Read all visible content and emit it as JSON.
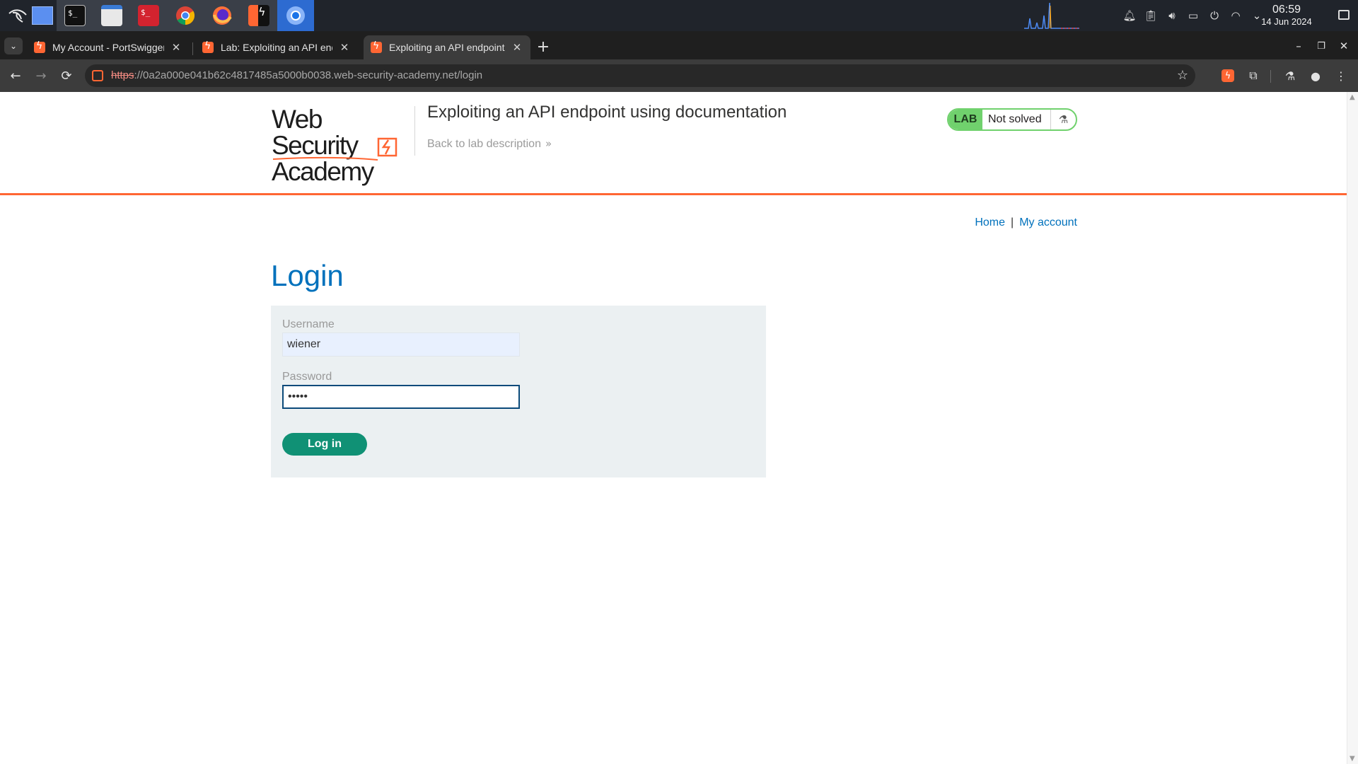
{
  "taskbar": {
    "apps": [
      {
        "name": "kali-menu"
      },
      {
        "name": "workspace-switcher"
      },
      {
        "name": "terminal"
      },
      {
        "name": "file-manager"
      },
      {
        "name": "terminal-root"
      },
      {
        "name": "chrome"
      },
      {
        "name": "firefox"
      },
      {
        "name": "burp-suite"
      },
      {
        "name": "chromium"
      }
    ],
    "clock_time": "06:59",
    "clock_date": "14 Jun 2024"
  },
  "browser": {
    "tabs": [
      {
        "title": "My Account - PortSwigger",
        "active": false
      },
      {
        "title": "Lab: Exploiting an API endpoint using documentation",
        "active": false
      },
      {
        "title": "Exploiting an API endpoint using documentation",
        "active": true
      }
    ],
    "url_scheme": "https",
    "url_host": "://0a2a000e041b62c4817485a5000b0038.web-security-academy.net",
    "url_path": "/login",
    "icons": {
      "back": "←",
      "forward": "→",
      "reload": "⟳",
      "star": "☆",
      "new_tab": "+",
      "minimize": "–",
      "restore": "❐",
      "close": "✕",
      "tab_close": "✕",
      "tabs_menu": "⌄",
      "burp_ext": "ϟ",
      "extensions": "⧉",
      "labs": "⚗",
      "profile": "●",
      "menu": "⋮"
    }
  },
  "academy": {
    "logo_line1": "Web Security",
    "logo_line2": "Academy",
    "lab_title": "Exploiting an API endpoint using documentation",
    "back_link": "Back to lab description",
    "back_chevron": "»",
    "lab_badge": "LAB",
    "lab_status": "Not solved",
    "flask_icon": "⚗",
    "colors": {
      "accent": "#ff6633",
      "link": "#0071bc",
      "button": "#109175",
      "badge": "#70d16d"
    }
  },
  "nav": {
    "home": "Home",
    "separator": "|",
    "my_account": "My account"
  },
  "login": {
    "heading": "Login",
    "username_label": "Username",
    "username_value": "wiener",
    "password_label": "Password",
    "password_value": "peter",
    "submit_label": "Log in"
  }
}
